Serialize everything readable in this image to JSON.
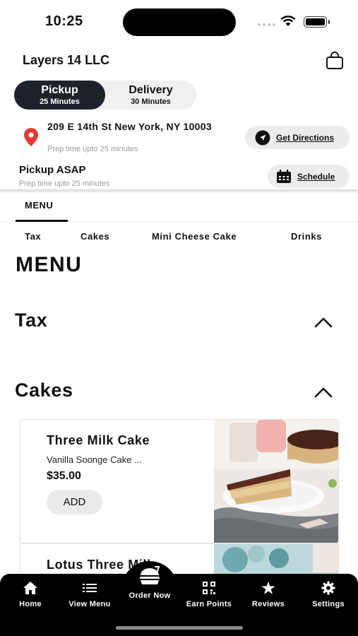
{
  "status_bar": {
    "time": "10:25"
  },
  "header": {
    "store_name": "Layers 14 LLC"
  },
  "mode_toggle": {
    "pickup_label": "Pickup",
    "pickup_time": "25 Minutes",
    "delivery_label": "Delivery",
    "delivery_time": "30 Minutes",
    "selected": "Pickup"
  },
  "location": {
    "address": "209 E 14th St New York, NY 10003",
    "prep_note": "Prep time upto 25 minutes",
    "directions_label": "Get Directions"
  },
  "pickup_time": {
    "label": "Pickup ASAP",
    "prep_note": "Prep time upto 25 minutes",
    "schedule_label": "Schedule"
  },
  "menu_tab": {
    "label": "MENU"
  },
  "categories": [
    "Tax",
    "Cakes",
    "Mini Cheese Cake",
    "Drinks"
  ],
  "menu_heading": "MENU",
  "sections": [
    {
      "title": "Tax"
    },
    {
      "title": "Cakes"
    }
  ],
  "products": [
    {
      "name": "Three Milk Cake",
      "description": "Vanilla Soonge Cake ...",
      "price": "$35.00",
      "add_label": "ADD"
    },
    {
      "name": "Lotus Three Milk"
    }
  ],
  "bottom_nav": {
    "home": "Home",
    "view_menu": "View Menu",
    "order_now": "Order Now",
    "earn_points": "Earn Points",
    "reviews": "Reviews",
    "settings": "Settings"
  },
  "colors": {
    "toggle_active": "#1f222a",
    "pin": "#e53935",
    "nav_bg": "#000000",
    "button_bg": "#ececec"
  }
}
